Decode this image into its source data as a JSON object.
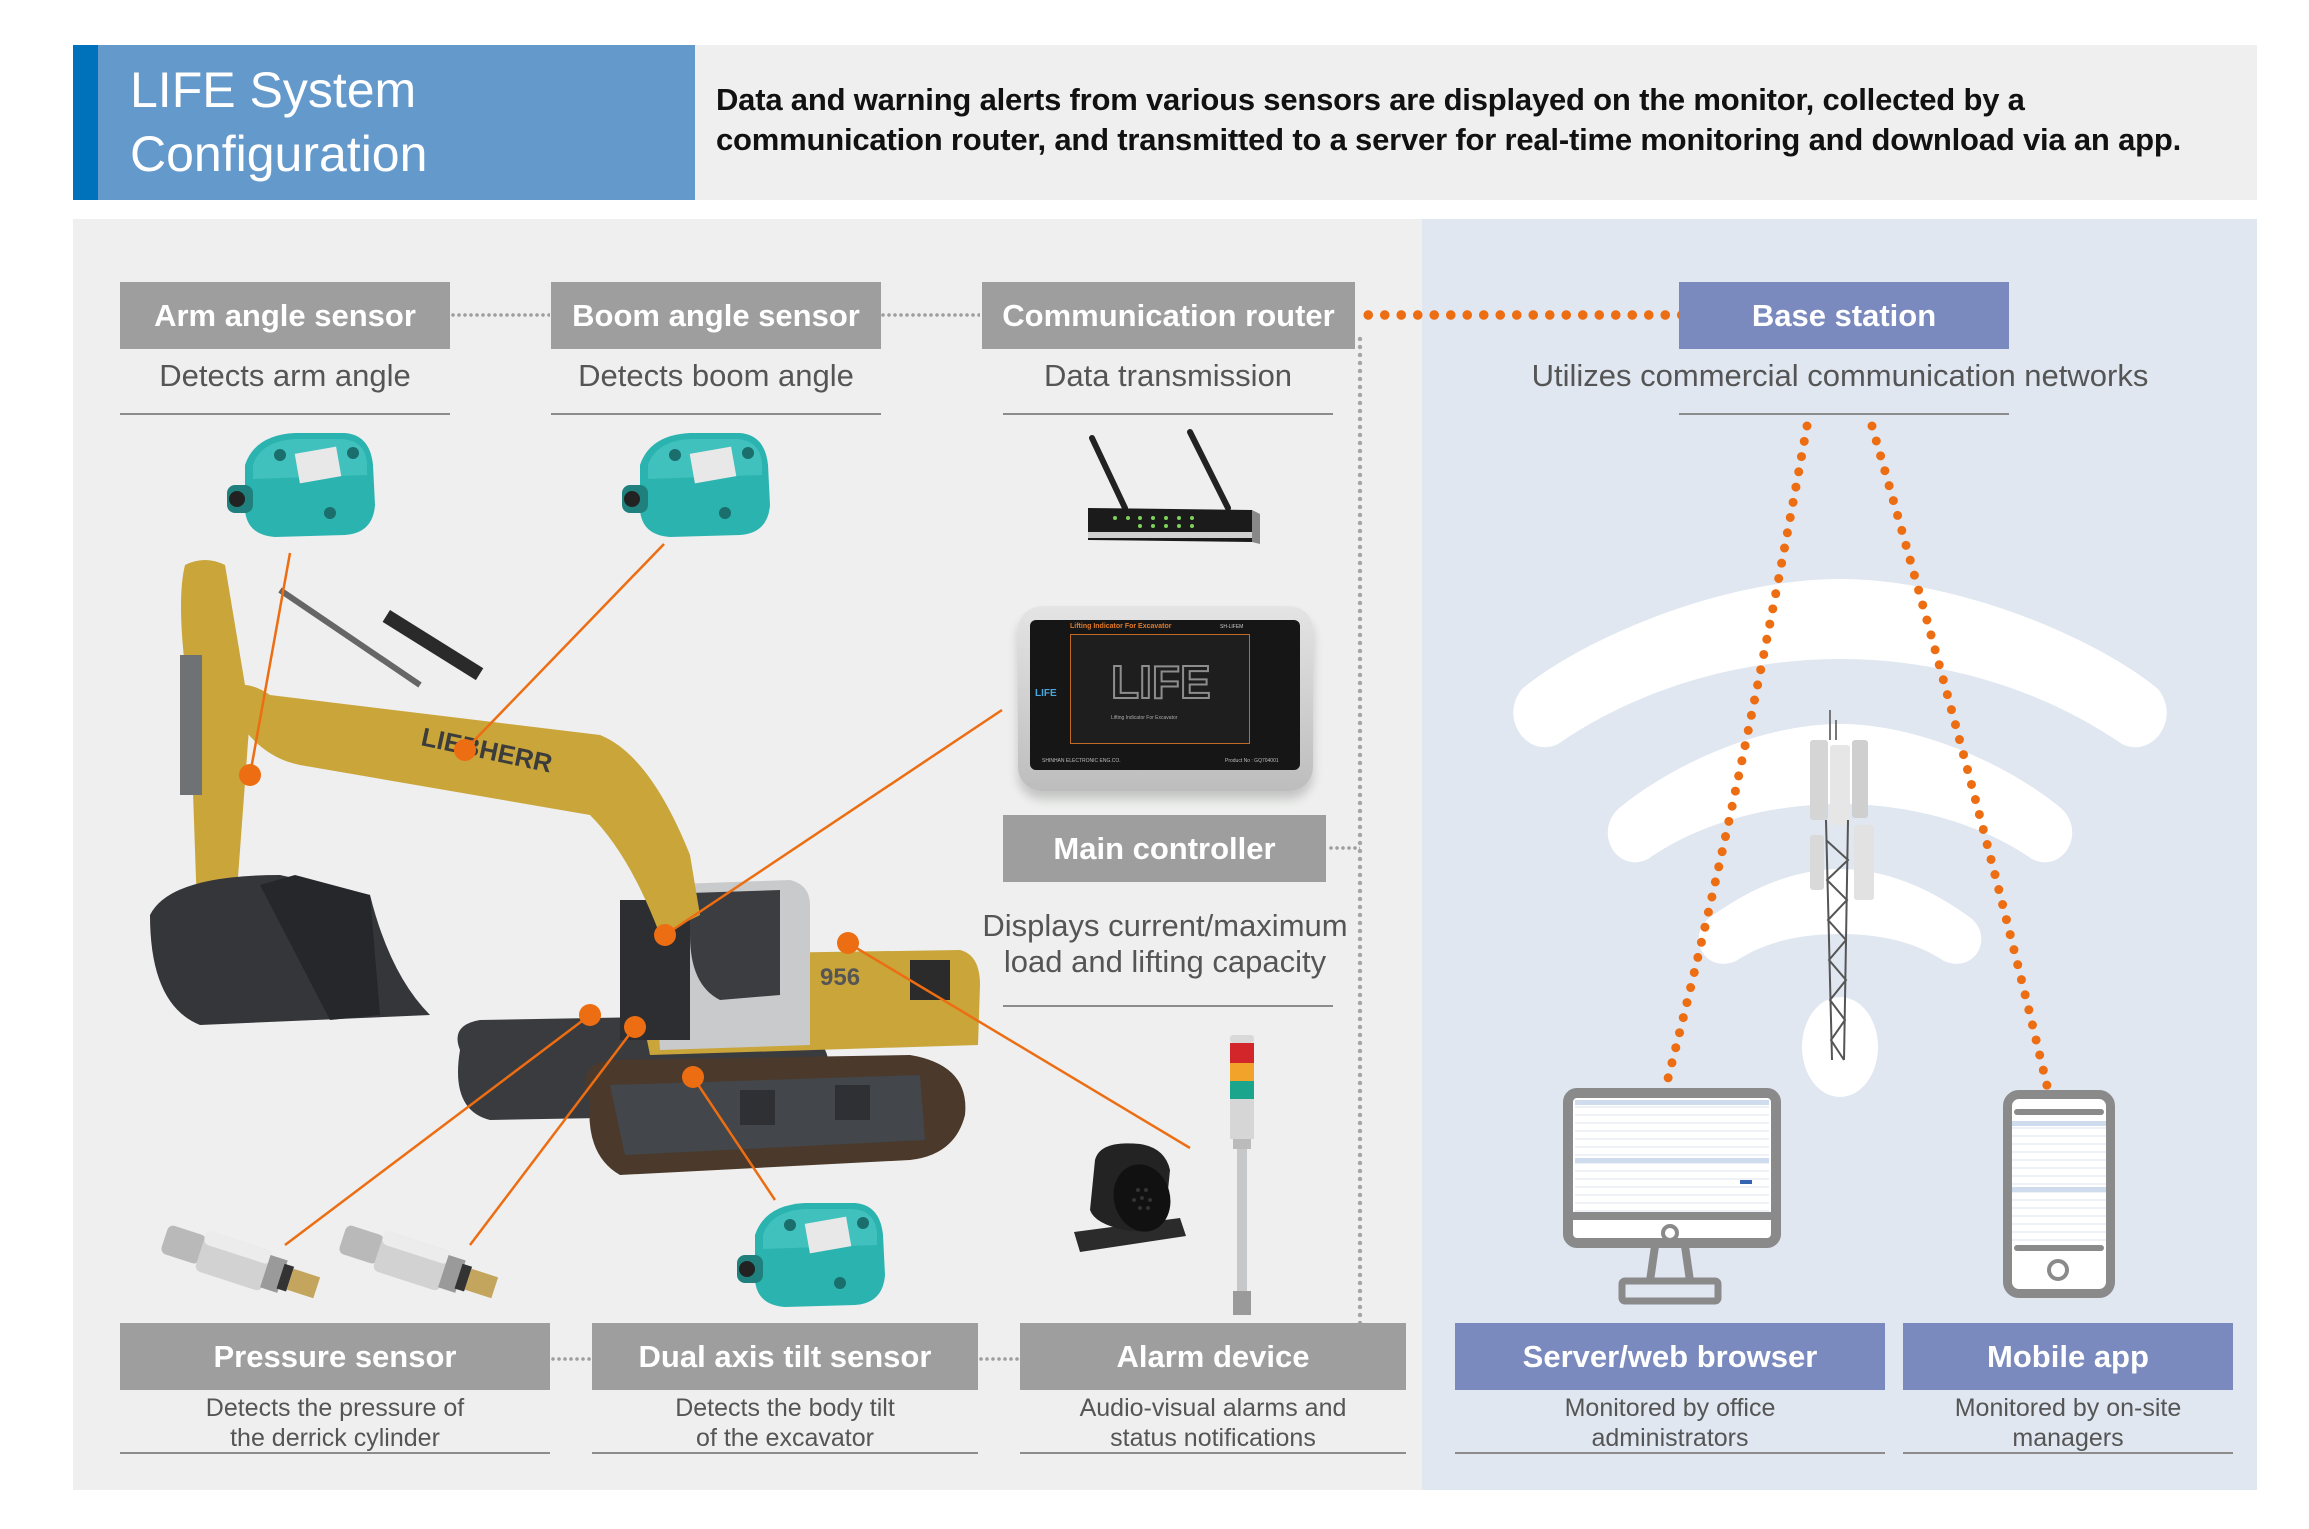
{
  "header": {
    "title_line1": "LIFE System",
    "title_line2": "Configuration",
    "description_line1": "Data and warning alerts from various sensors are displayed on the monitor, collected by a",
    "description_line2": "communication router, and transmitted to a server for real-time monitoring and download via an app."
  },
  "components": {
    "arm_angle_sensor": {
      "label": "Arm angle sensor",
      "desc": "Detects arm angle"
    },
    "boom_angle_sensor": {
      "label": "Boom angle sensor",
      "desc": "Detects boom angle"
    },
    "communication_router": {
      "label": "Communication router",
      "desc": "Data transmission"
    },
    "base_station": {
      "label": "Base station",
      "desc": "Utilizes commercial communication networks"
    },
    "main_controller": {
      "label": "Main controller",
      "desc_line1": "Displays current/maximum",
      "desc_line2": "load and lifting capacity"
    },
    "pressure_sensor": {
      "label": "Pressure sensor",
      "desc_line1": "Detects the pressure of",
      "desc_line2": "the derrick cylinder"
    },
    "dual_axis_tilt_sensor": {
      "label": "Dual axis tilt sensor",
      "desc_line1": "Detects the body tilt",
      "desc_line2": "of the excavator"
    },
    "alarm_device": {
      "label": "Alarm device",
      "desc_line1": "Audio-visual alarms and",
      "desc_line2": "status notifications"
    },
    "server_web_browser": {
      "label": "Server/web browser",
      "desc_line1": "Monitored by office",
      "desc_line2": "administrators"
    },
    "mobile_app": {
      "label": "Mobile app",
      "desc_line1": "Monitored by on-site",
      "desc_line2": "managers"
    }
  },
  "controller_screen": {
    "header_text": "Lifting Indicator For Excavator",
    "model": "SH-LIFEM",
    "logo_text": "LIFE",
    "logo_subtitle": "Lifting Indicator For Excavator",
    "maker": "SHINHAN ELECTRONIC ENG.CO.",
    "product_no": "Product No : GQ704001"
  },
  "excavator": {
    "brand": "LIEBHERR",
    "model": "956"
  },
  "colors": {
    "header_blue": "#6499cc",
    "header_accent": "#0072bc",
    "label_gray": "#9e9e9e",
    "label_blue": "#7b8abe",
    "connector_orange": "#ed6d12",
    "left_panel_bg": "#eeefee",
    "right_panel_bg": "#e0e7f1",
    "sensor_teal": "#2bb3b0",
    "excavator_yellow": "#c9a53a"
  }
}
